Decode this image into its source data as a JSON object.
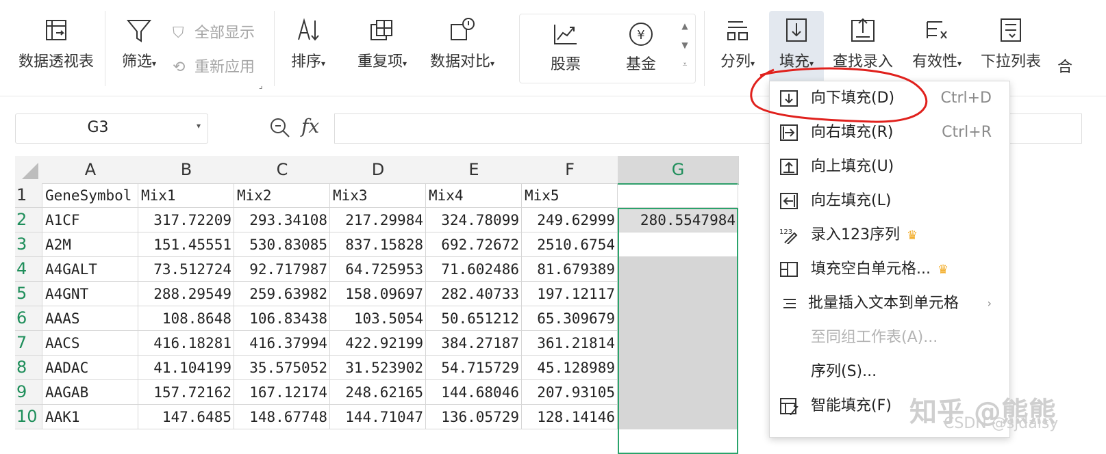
{
  "ribbon": {
    "pivot_label": "数据透视表",
    "filter_label": "筛选",
    "show_all_label": "全部显示",
    "reapply_label": "重新应用",
    "sort_label": "排序",
    "duplicates_label": "重复项",
    "compare_label": "数据对比",
    "stock_label": "股票",
    "fund_label": "基金",
    "split_label": "分列",
    "fill_label": "填充",
    "lookup_label": "查找录入",
    "validity_label": "有效性",
    "dropdown_list_label": "下拉列表",
    "merge_label": "合",
    "fund_symbol": "¥"
  },
  "formula_bar": {
    "name_box": "G3",
    "fx": "fx",
    "formula": ""
  },
  "sheet": {
    "columns": [
      "A",
      "B",
      "C",
      "D",
      "E",
      "F",
      "G"
    ],
    "selected_column": "G",
    "row_numbers": [
      "1",
      "2",
      "3",
      "4",
      "5",
      "6",
      "7",
      "8",
      "9",
      "10"
    ],
    "rows": [
      [
        "GeneSymbol",
        "Mix1",
        "Mix2",
        "Mix3",
        "Mix4",
        "Mix5",
        ""
      ],
      [
        "A1CF",
        "317.72209",
        "293.34108",
        "217.29984",
        "324.78099",
        "249.62999",
        "280.5547984"
      ],
      [
        "A2M",
        "151.45551",
        "530.83085",
        "837.15828",
        "692.72672",
        "2510.6754",
        ""
      ],
      [
        "A4GALT",
        "73.512724",
        "92.717987",
        "64.725953",
        "71.602486",
        "81.679389",
        ""
      ],
      [
        "A4GNT",
        "288.29549",
        "259.63982",
        "158.09697",
        "282.40733",
        "197.12117",
        ""
      ],
      [
        "AAAS",
        "108.8648",
        "106.83438",
        "103.5054",
        "50.651212",
        "65.309679",
        ""
      ],
      [
        "AACS",
        "416.18281",
        "416.37994",
        "422.92199",
        "384.27187",
        "361.21814",
        ""
      ],
      [
        "AADAC",
        "41.104199",
        "35.575052",
        "31.523902",
        "54.715729",
        "45.128989",
        ""
      ],
      [
        "AAGAB",
        "157.72162",
        "167.12174",
        "248.62165",
        "144.68046",
        "207.93105",
        ""
      ],
      [
        "AAK1",
        "147.6485",
        "148.67748",
        "144.71047",
        "136.05729",
        "128.14146",
        ""
      ]
    ]
  },
  "fill_menu": {
    "items": [
      {
        "label": "向下填充(D)",
        "shortcut": "Ctrl+D",
        "icon": "fill-down-icon"
      },
      {
        "label": "向右填充(R)",
        "shortcut": "Ctrl+R",
        "icon": "fill-right-icon"
      },
      {
        "label": "向上填充(U)",
        "shortcut": "",
        "icon": "fill-up-icon"
      },
      {
        "label": "向左填充(L)",
        "shortcut": "",
        "icon": "fill-left-icon"
      },
      {
        "label": "录入123序列",
        "shortcut": "",
        "icon": "sequence-123-icon",
        "premium": true
      },
      {
        "label": "填充空白单元格...",
        "shortcut": "",
        "icon": "fill-blank-icon",
        "premium": true
      },
      {
        "label": "批量插入文本到单元格",
        "shortcut": "",
        "icon": "insert-text-icon",
        "submenu": true
      },
      {
        "label": "至同组工作表(A)...",
        "shortcut": "",
        "icon": "",
        "disabled": true
      },
      {
        "label": "序列(S)...",
        "shortcut": "",
        "icon": ""
      },
      {
        "label": "智能填充(F)",
        "shortcut": "",
        "icon": "smart-fill-icon"
      }
    ],
    "seq_icon_text": "123"
  },
  "watermark": {
    "site": "知乎 @熊熊",
    "csdn": "CSDN @sjdaisy"
  },
  "colors": {
    "accent_green": "#2aa36b",
    "annotation_red": "#e0211d",
    "premium_gold": "#f2a81d"
  }
}
